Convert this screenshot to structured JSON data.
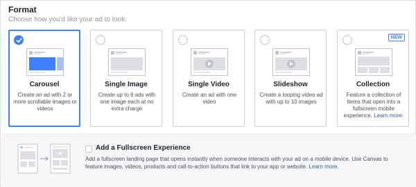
{
  "format": {
    "title": "Format",
    "subtitle": "Choose how you'd like your ad to look."
  },
  "cards": [
    {
      "title": "Carousel",
      "description": "Create an ad with 2 or more scrollable images or videos",
      "selected": true,
      "thumb": "carousel"
    },
    {
      "title": "Single Image",
      "description": "Create up to 6 ads with one image each at no extra charge",
      "selected": false,
      "thumb": "image"
    },
    {
      "title": "Single Video",
      "description": "Create an ad with one video",
      "selected": false,
      "thumb": "video"
    },
    {
      "title": "Slideshow",
      "description": "Create a looping video ad with up to 10 images",
      "selected": false,
      "thumb": "video"
    },
    {
      "title": "Collection",
      "description": "Feature a collection of items that open into a fullscreen mobile experience.",
      "link": "Learn more.",
      "badge": "NEW",
      "selected": false,
      "thumb": "collection"
    }
  ],
  "fullscreen": {
    "title": "Add a Fullscreen Experience",
    "description": "Add a fullscreen landing page that opens instantly when someone interacts with your ad on a mobile device. Use Canvas to feature images, videos, products and call-to-action buttons that link to your app or website.",
    "link": "Learn more.",
    "checked": false
  },
  "colors": {
    "accent": "#4080ff",
    "link": "#365899",
    "card_border": "#ccd0d5",
    "panel_bg": "#f6f7f9"
  }
}
